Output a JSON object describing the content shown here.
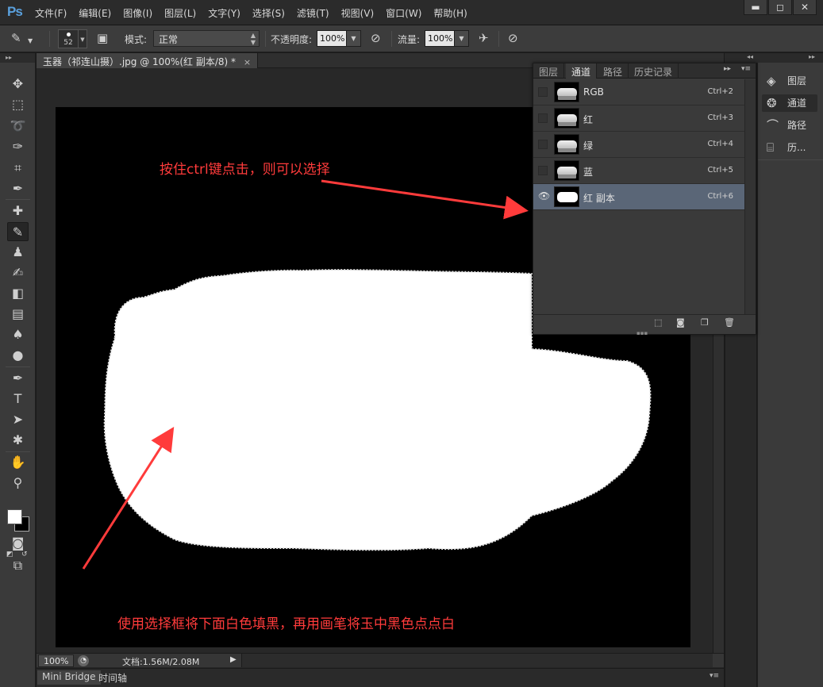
{
  "app": {
    "logo": "Ps",
    "menu": [
      "文件(F)",
      "编辑(E)",
      "图像(I)",
      "图层(L)",
      "文字(Y)",
      "选择(S)",
      "滤镜(T)",
      "视图(V)",
      "窗口(W)",
      "帮助(H)"
    ],
    "window_buttons": [
      "▬",
      "◻",
      "✕"
    ]
  },
  "options": {
    "brush_size": "52",
    "mode_label": "模式:",
    "mode_value": "正常",
    "opacity_label": "不透明度:",
    "opacity_value": "100%",
    "flow_label": "流量:",
    "flow_value": "100%"
  },
  "document": {
    "tab_title": "玉器（祁连山摄）.jpg @ 100%(红 副本/8) *",
    "tab_close": "×",
    "annotation_top": "按住ctrl键点击，则可以选择",
    "annotation_bottom": "使用选择框将下面白色填黑，再用画笔将玉中黑色点点白",
    "annotation_color": "#ff3b3b",
    "zoom": "100%",
    "doc_size": "文档:1.56M/2.08M"
  },
  "bottom_tabs": [
    "Mini Bridge",
    "时间轴"
  ],
  "channels_panel": {
    "tabs": [
      "图层",
      "通道",
      "路径",
      "历史记录"
    ],
    "active_tab": "通道",
    "rows": [
      {
        "name": "RGB",
        "shortcut": "Ctrl+2",
        "visible": false,
        "selected": false
      },
      {
        "name": "红",
        "shortcut": "Ctrl+3",
        "visible": false,
        "selected": false
      },
      {
        "name": "绿",
        "shortcut": "Ctrl+4",
        "visible": false,
        "selected": false
      },
      {
        "name": "蓝",
        "shortcut": "Ctrl+5",
        "visible": false,
        "selected": false
      },
      {
        "name": "红 副本",
        "shortcut": "Ctrl+6",
        "visible": true,
        "selected": true
      }
    ],
    "selected_row_color": "#5a6677"
  },
  "dock": {
    "items": [
      {
        "label": "图层",
        "icon": "layers-icon"
      },
      {
        "label": "通道",
        "icon": "channels-icon"
      },
      {
        "label": "路径",
        "icon": "paths-icon"
      },
      {
        "label": "历...",
        "icon": "history-icon"
      }
    ]
  }
}
